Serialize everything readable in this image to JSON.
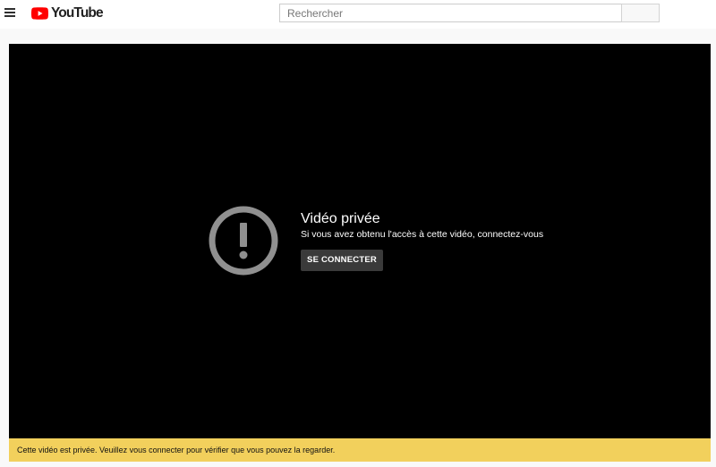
{
  "header": {
    "menu_icon": "hamburger-menu-icon",
    "logo_icon": "youtube-play-icon",
    "logo_text": "YouTube",
    "brand_color": "#ff0000",
    "search": {
      "placeholder": "Rechercher",
      "value": "",
      "button_icon": "search-icon"
    }
  },
  "player": {
    "error_icon": "exclamation-circle-icon",
    "title": "Vidéo privée",
    "subtitle": "Si vous avez obtenu l'accès à cette vidéo, connectez-vous",
    "signin_label": "SE CONNECTER"
  },
  "alert": {
    "message": "Cette vidéo est privée. Veuillez vous connecter pour vérifier que vous pouvez la regarder.",
    "color": "#f2d05c"
  }
}
